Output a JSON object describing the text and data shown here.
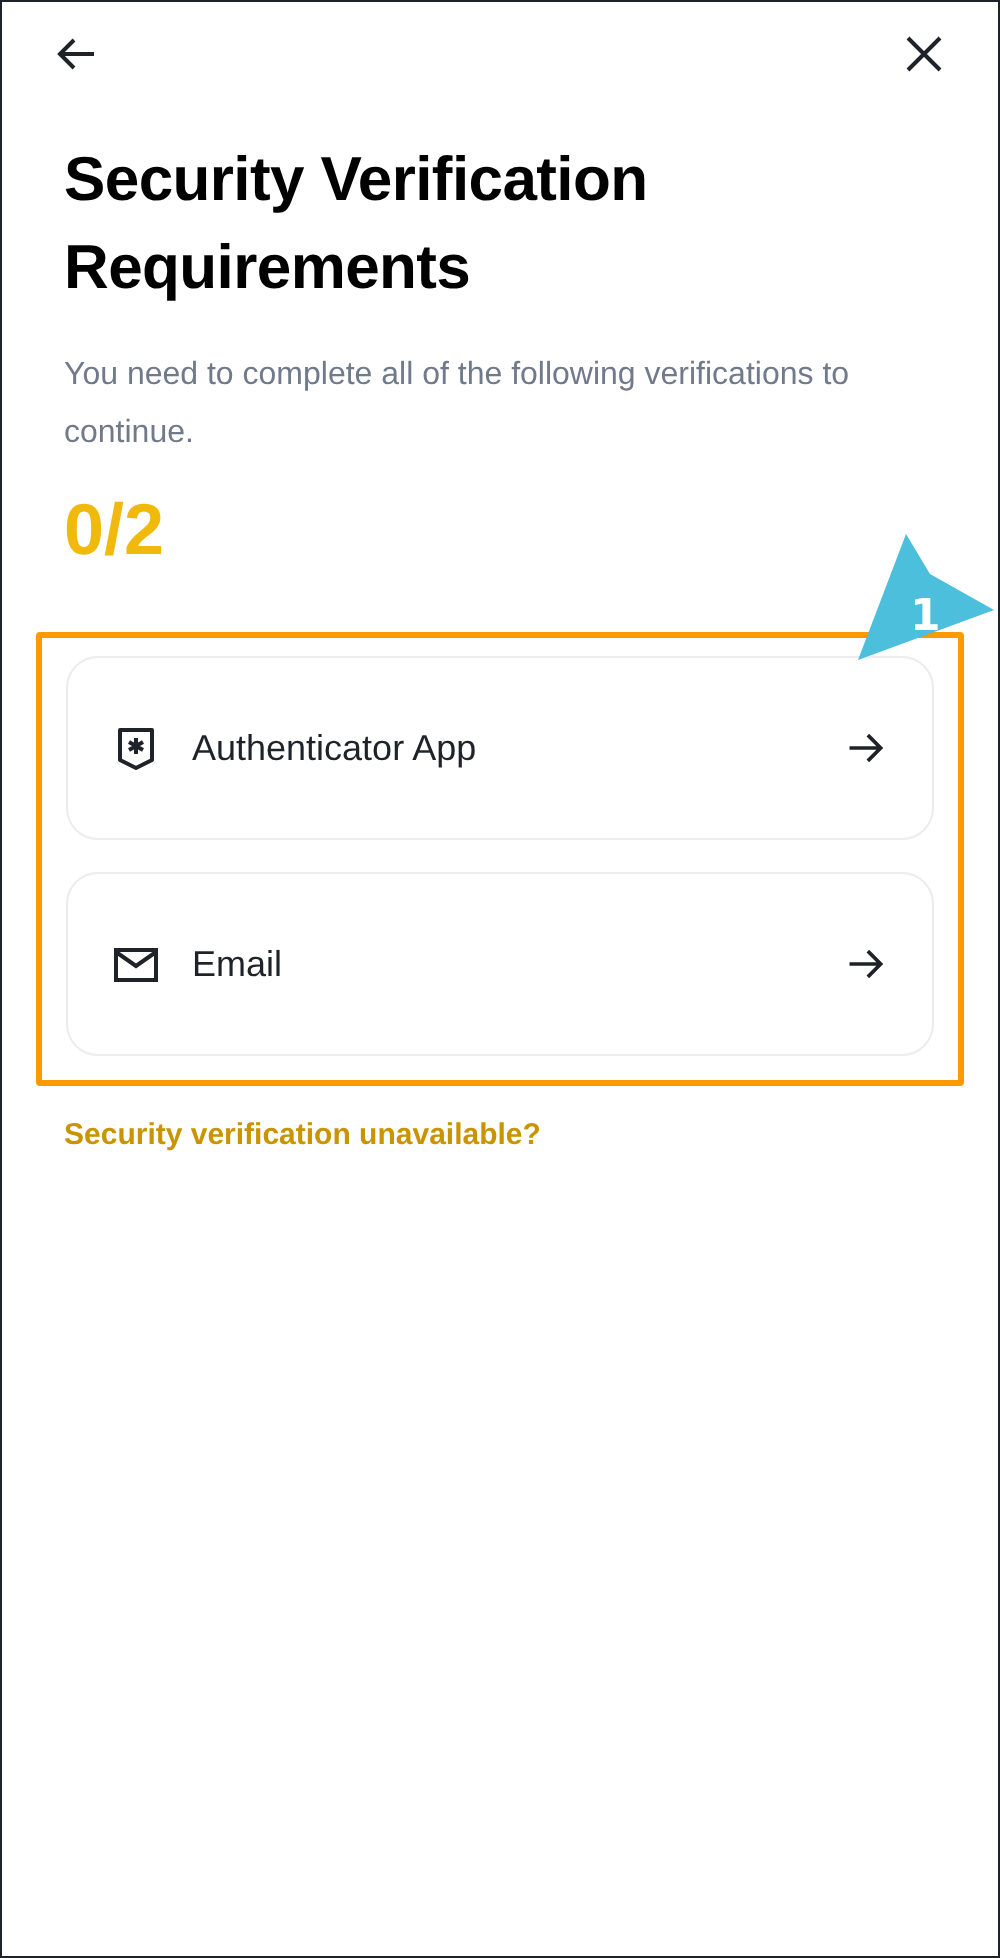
{
  "title": "Security Verification Requirements",
  "subtitle": "You need to complete all of the following verifications to continue.",
  "progress": "0/2",
  "methods": [
    {
      "kind": "authenticator",
      "label": "Authenticator App"
    },
    {
      "kind": "email",
      "label": "Email"
    }
  ],
  "annotation": {
    "number": "1"
  },
  "help_link": "Security verification unavailable?"
}
